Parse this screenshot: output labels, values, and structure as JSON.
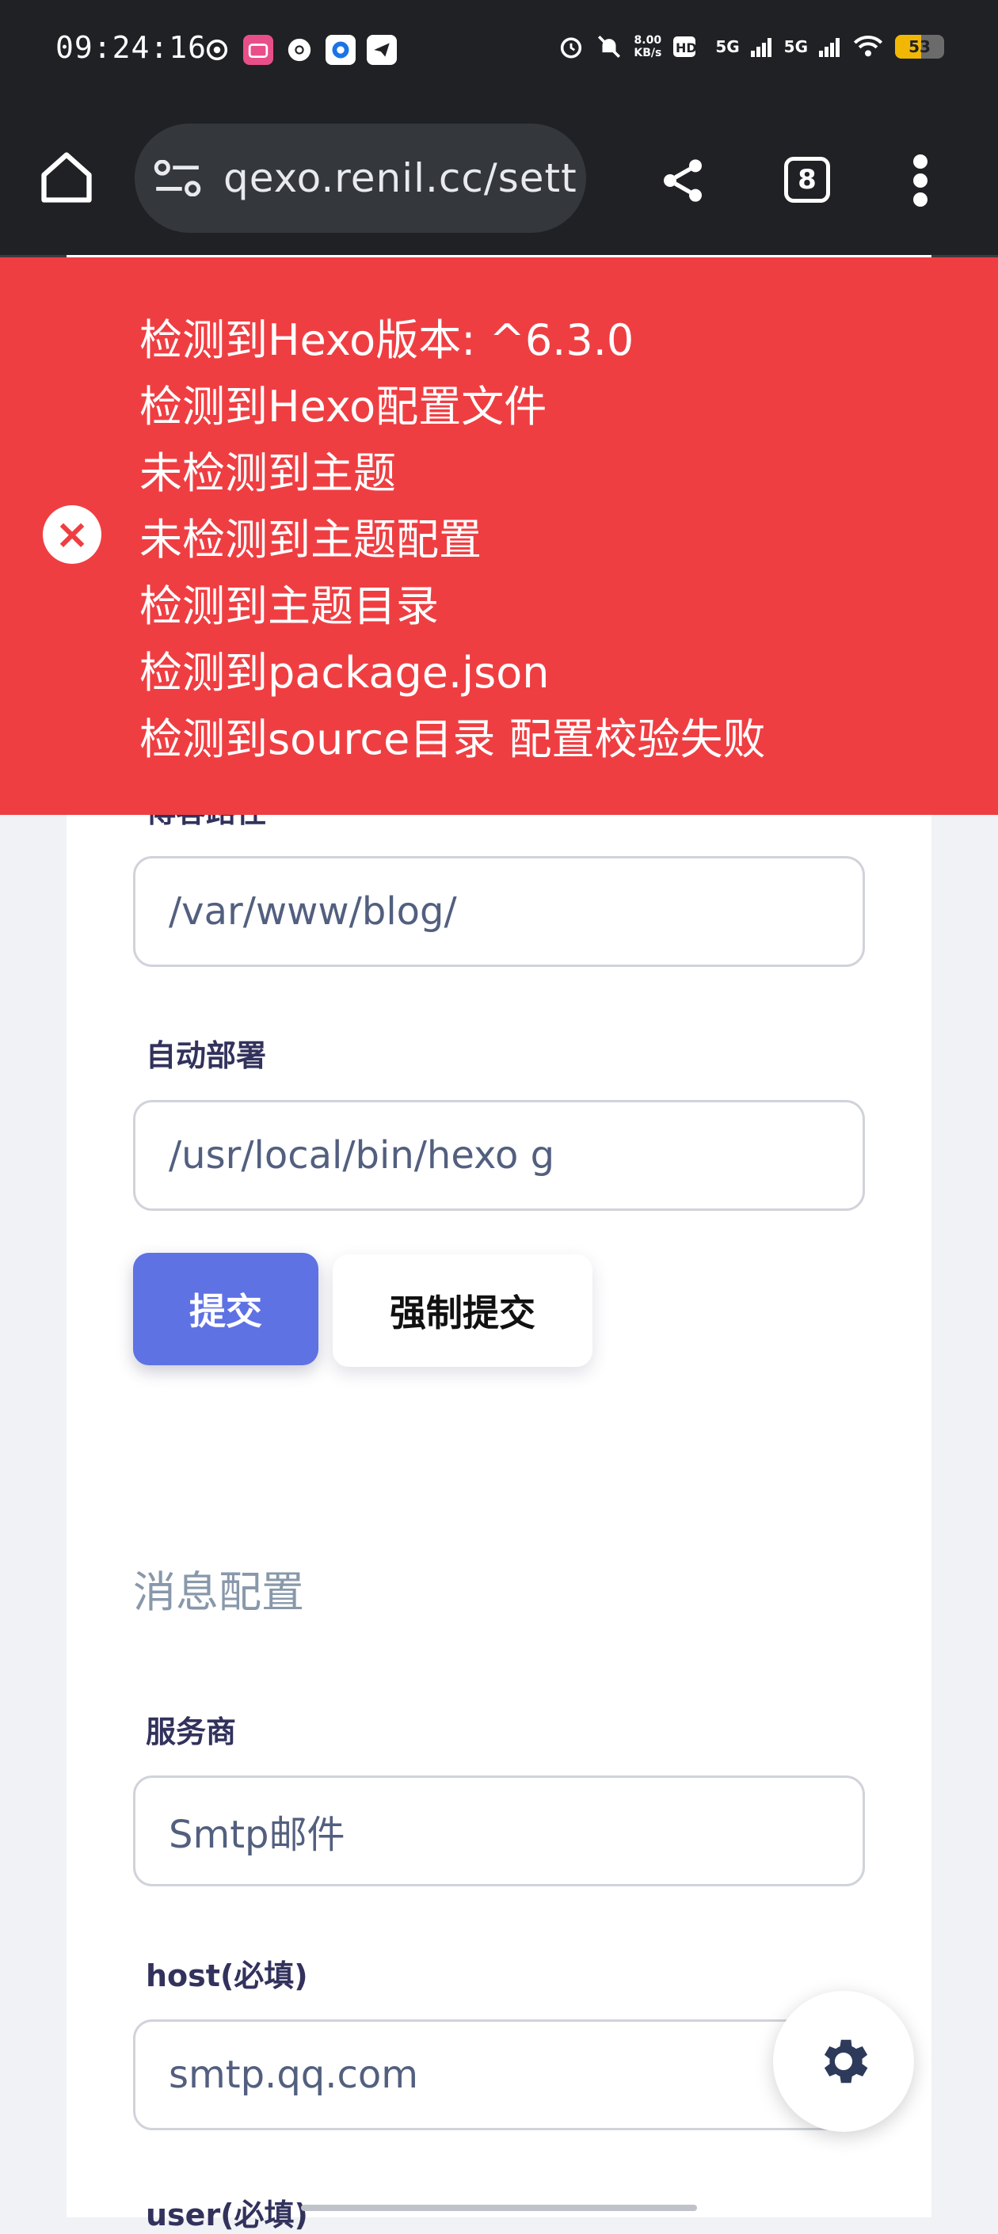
{
  "status_bar": {
    "time": "09:24:16",
    "net_speed_value": "8.00",
    "net_speed_unit": "KB/s",
    "signal_1": "5G",
    "signal_2": "5G",
    "battery": "53",
    "battery_level": 0.53,
    "battery_color": "#f2b705"
  },
  "browser": {
    "url": "qexo.renil.cc/sett",
    "tab_count": "8"
  },
  "alert": {
    "color": "#ef3e42",
    "lines": [
      "检测到Hexo版本: ^6.3.0",
      "检测到Hexo配置文件",
      "未检测到主题",
      "未检测到主题配置",
      "检测到主题目录",
      "检测到package.json",
      "检测到source目录 配置校验失败"
    ]
  },
  "form": {
    "path_label": "博客路径",
    "path_value": "/var/www/blog/",
    "deploy_label": "自动部署",
    "deploy_value": "/usr/local/bin/hexo g",
    "submit_label": "提交",
    "force_submit_label": "强制提交"
  },
  "message_config": {
    "title": "消息配置",
    "provider_label": "服务商",
    "provider_value": "Smtp邮件",
    "host_label": "host(必填)",
    "host_value": "smtp.qq.com",
    "user_label": "user(必填)"
  },
  "icons": {
    "alert": "close-circle-icon",
    "fab": "gear-icon"
  },
  "colors": {
    "primary": "#5e72e4",
    "toolbar": "#1f2124"
  }
}
